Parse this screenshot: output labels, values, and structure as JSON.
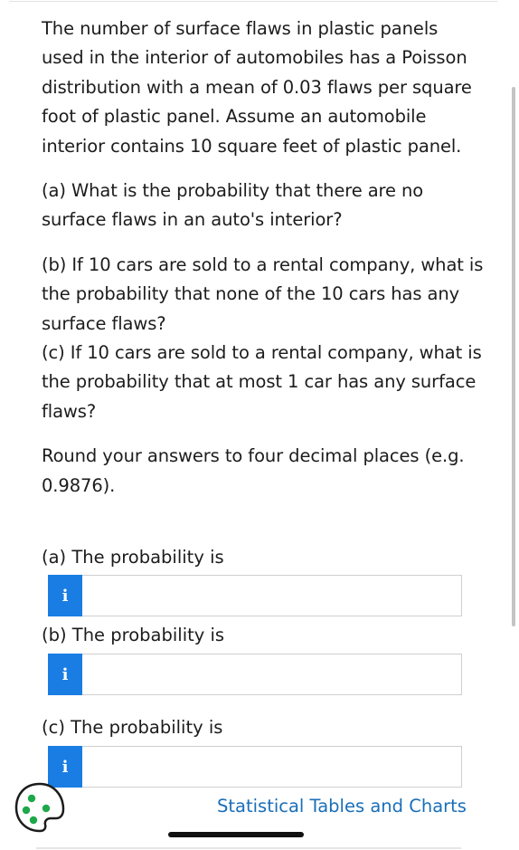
{
  "question": {
    "intro": "The number of surface flaws in plastic panels used in the interior of automobiles has a Poisson distribution with a mean of 0.03 flaws per square foot of plastic panel. Assume an automobile interior contains 10 square feet of plastic panel.",
    "part_a": "(a) What is the probability that there are no surface flaws in an auto's interior?",
    "part_b": "(b) If 10 cars are sold to a rental company, what is the probability that none of the 10 cars has any surface flaws?",
    "part_c": "(c) If 10 cars are sold to a rental company, what is the probability that at most 1 car has any surface flaws?",
    "rounding": "Round your answers to four decimal places (e.g. 0.9876)."
  },
  "answers": [
    {
      "label": "(a) The probability is",
      "info_glyph": "i",
      "value": ""
    },
    {
      "label": "(b) The probability is",
      "info_glyph": "i",
      "value": ""
    },
    {
      "label": "(c) The probability is",
      "info_glyph": "i",
      "value": ""
    }
  ],
  "footer": {
    "palette_icon": "palette-icon",
    "link_text": "Statistical Tables and Charts"
  },
  "colors": {
    "info_button": "#1a7de3",
    "link": "#1a6fb8",
    "palette_dots": "#1ea84a"
  }
}
